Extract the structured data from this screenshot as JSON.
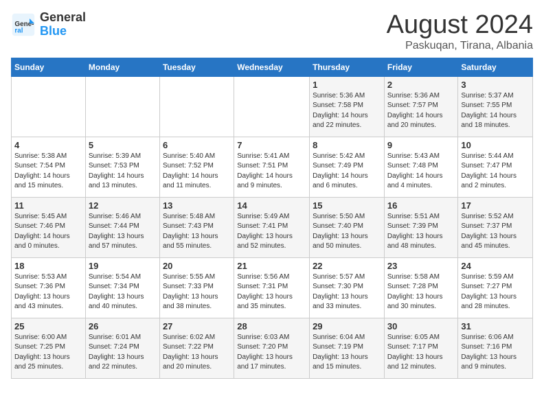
{
  "logo": {
    "general": "General",
    "blue": "Blue"
  },
  "calendar": {
    "title": "August 2024",
    "subtitle": "Paskuqan, Tirana, Albania"
  },
  "weekdays": [
    "Sunday",
    "Monday",
    "Tuesday",
    "Wednesday",
    "Thursday",
    "Friday",
    "Saturday"
  ],
  "weeks": [
    [
      {
        "day": "",
        "info": ""
      },
      {
        "day": "",
        "info": ""
      },
      {
        "day": "",
        "info": ""
      },
      {
        "day": "",
        "info": ""
      },
      {
        "day": "1",
        "info": "Sunrise: 5:36 AM\nSunset: 7:58 PM\nDaylight: 14 hours\nand 22 minutes."
      },
      {
        "day": "2",
        "info": "Sunrise: 5:36 AM\nSunset: 7:57 PM\nDaylight: 14 hours\nand 20 minutes."
      },
      {
        "day": "3",
        "info": "Sunrise: 5:37 AM\nSunset: 7:55 PM\nDaylight: 14 hours\nand 18 minutes."
      }
    ],
    [
      {
        "day": "4",
        "info": "Sunrise: 5:38 AM\nSunset: 7:54 PM\nDaylight: 14 hours\nand 15 minutes."
      },
      {
        "day": "5",
        "info": "Sunrise: 5:39 AM\nSunset: 7:53 PM\nDaylight: 14 hours\nand 13 minutes."
      },
      {
        "day": "6",
        "info": "Sunrise: 5:40 AM\nSunset: 7:52 PM\nDaylight: 14 hours\nand 11 minutes."
      },
      {
        "day": "7",
        "info": "Sunrise: 5:41 AM\nSunset: 7:51 PM\nDaylight: 14 hours\nand 9 minutes."
      },
      {
        "day": "8",
        "info": "Sunrise: 5:42 AM\nSunset: 7:49 PM\nDaylight: 14 hours\nand 6 minutes."
      },
      {
        "day": "9",
        "info": "Sunrise: 5:43 AM\nSunset: 7:48 PM\nDaylight: 14 hours\nand 4 minutes."
      },
      {
        "day": "10",
        "info": "Sunrise: 5:44 AM\nSunset: 7:47 PM\nDaylight: 14 hours\nand 2 minutes."
      }
    ],
    [
      {
        "day": "11",
        "info": "Sunrise: 5:45 AM\nSunset: 7:46 PM\nDaylight: 14 hours\nand 0 minutes."
      },
      {
        "day": "12",
        "info": "Sunrise: 5:46 AM\nSunset: 7:44 PM\nDaylight: 13 hours\nand 57 minutes."
      },
      {
        "day": "13",
        "info": "Sunrise: 5:48 AM\nSunset: 7:43 PM\nDaylight: 13 hours\nand 55 minutes."
      },
      {
        "day": "14",
        "info": "Sunrise: 5:49 AM\nSunset: 7:41 PM\nDaylight: 13 hours\nand 52 minutes."
      },
      {
        "day": "15",
        "info": "Sunrise: 5:50 AM\nSunset: 7:40 PM\nDaylight: 13 hours\nand 50 minutes."
      },
      {
        "day": "16",
        "info": "Sunrise: 5:51 AM\nSunset: 7:39 PM\nDaylight: 13 hours\nand 48 minutes."
      },
      {
        "day": "17",
        "info": "Sunrise: 5:52 AM\nSunset: 7:37 PM\nDaylight: 13 hours\nand 45 minutes."
      }
    ],
    [
      {
        "day": "18",
        "info": "Sunrise: 5:53 AM\nSunset: 7:36 PM\nDaylight: 13 hours\nand 43 minutes."
      },
      {
        "day": "19",
        "info": "Sunrise: 5:54 AM\nSunset: 7:34 PM\nDaylight: 13 hours\nand 40 minutes."
      },
      {
        "day": "20",
        "info": "Sunrise: 5:55 AM\nSunset: 7:33 PM\nDaylight: 13 hours\nand 38 minutes."
      },
      {
        "day": "21",
        "info": "Sunrise: 5:56 AM\nSunset: 7:31 PM\nDaylight: 13 hours\nand 35 minutes."
      },
      {
        "day": "22",
        "info": "Sunrise: 5:57 AM\nSunset: 7:30 PM\nDaylight: 13 hours\nand 33 minutes."
      },
      {
        "day": "23",
        "info": "Sunrise: 5:58 AM\nSunset: 7:28 PM\nDaylight: 13 hours\nand 30 minutes."
      },
      {
        "day": "24",
        "info": "Sunrise: 5:59 AM\nSunset: 7:27 PM\nDaylight: 13 hours\nand 28 minutes."
      }
    ],
    [
      {
        "day": "25",
        "info": "Sunrise: 6:00 AM\nSunset: 7:25 PM\nDaylight: 13 hours\nand 25 minutes."
      },
      {
        "day": "26",
        "info": "Sunrise: 6:01 AM\nSunset: 7:24 PM\nDaylight: 13 hours\nand 22 minutes."
      },
      {
        "day": "27",
        "info": "Sunrise: 6:02 AM\nSunset: 7:22 PM\nDaylight: 13 hours\nand 20 minutes."
      },
      {
        "day": "28",
        "info": "Sunrise: 6:03 AM\nSunset: 7:20 PM\nDaylight: 13 hours\nand 17 minutes."
      },
      {
        "day": "29",
        "info": "Sunrise: 6:04 AM\nSunset: 7:19 PM\nDaylight: 13 hours\nand 15 minutes."
      },
      {
        "day": "30",
        "info": "Sunrise: 6:05 AM\nSunset: 7:17 PM\nDaylight: 13 hours\nand 12 minutes."
      },
      {
        "day": "31",
        "info": "Sunrise: 6:06 AM\nSunset: 7:16 PM\nDaylight: 13 hours\nand 9 minutes."
      }
    ]
  ]
}
